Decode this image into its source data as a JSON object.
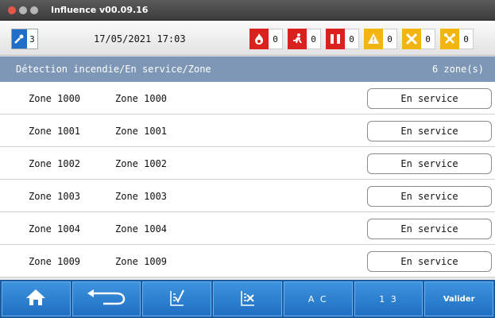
{
  "window": {
    "title": "Influence v00.09.16"
  },
  "header": {
    "access_level": "3",
    "datetime": "17/05/2021 17:03",
    "alarms": [
      {
        "icon": "fire-icon",
        "count": "0"
      },
      {
        "icon": "evacuation-icon",
        "count": "0"
      },
      {
        "icon": "door-icon",
        "count": "0"
      },
      {
        "icon": "warning-icon",
        "count": "0"
      },
      {
        "icon": "fault-cross-icon",
        "count": "0"
      },
      {
        "icon": "maintenance-tools-icon",
        "count": "0"
      }
    ]
  },
  "breadcrumb": {
    "path": "Détection incendie/En service/Zone",
    "count": "6 zone(s)"
  },
  "zones": [
    {
      "id": "Zone 1000",
      "name": "Zone 1000",
      "state": "En service"
    },
    {
      "id": "Zone 1001",
      "name": "Zone 1001",
      "state": "En service"
    },
    {
      "id": "Zone 1002",
      "name": "Zone 1002",
      "state": "En service"
    },
    {
      "id": "Zone 1003",
      "name": "Zone 1003",
      "state": "En service"
    },
    {
      "id": "Zone 1004",
      "name": "Zone 1004",
      "state": "En service"
    },
    {
      "id": "Zone 1009",
      "name": "Zone 1009",
      "state": "En service"
    }
  ],
  "toolbar": {
    "search_alpha_label": "A  C",
    "search_num_label": "1  3",
    "validate_label": "Valider"
  },
  "colors": {
    "header_blue": "#1f6fc9",
    "breadcrumb_bar": "#7e97b6",
    "alarm_red": "#d9221b",
    "alarm_yellow": "#f2b511",
    "toolbar_blue": "#1c5aa0"
  }
}
